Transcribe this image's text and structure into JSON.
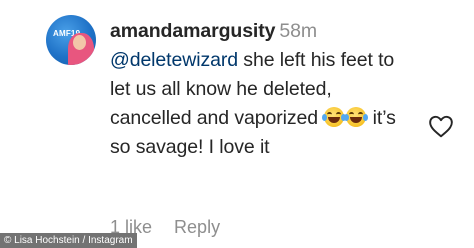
{
  "comment": {
    "username": "amandamargusity",
    "time": "58m",
    "mention": "@deletewizard",
    "text_1": " she left his feet to let us all know he deleted, cancelled and vaporized ",
    "text_2": " it’s so savage! I love it",
    "emoji_icons": [
      "face-with-tears-of-joy-icon",
      "face-with-tears-of-joy-icon"
    ]
  },
  "avatar": {
    "text": "AMF19"
  },
  "actions": {
    "likes": "1 like",
    "reply": "Reply"
  },
  "credit": {
    "text": "© Lisa Hochstein / Instagram"
  },
  "colors": {
    "username": "#262626",
    "meta": "#8e8e8e",
    "mention": "#00376b",
    "avatar_bg": "#1f72c7"
  }
}
